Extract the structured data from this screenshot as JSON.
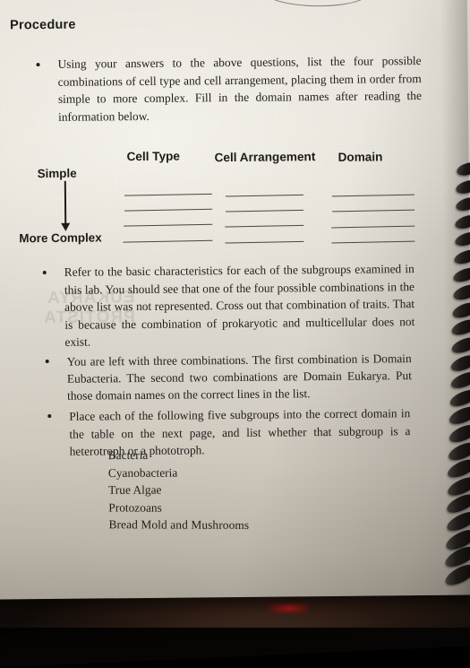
{
  "document": {
    "section_heading": "Procedure",
    "media": "photograph of a spiral-bound lab manual page"
  },
  "instructions": [
    {
      "id": "bullet-1",
      "text": "Using your answers to the above questions, list the four possible combinations of cell type and cell arrangement, placing them in order from simple to more complex. Fill in the domain names after reading the information below."
    },
    {
      "id": "bullet-2",
      "text": "Refer to the basic characteristics for each of the subgroups examined in this lab. You should see that one of the four possible combinations in the above list was not represented. Cross out that combination of traits. That is because the combination of prokaryotic and multicellular does not exist."
    },
    {
      "id": "bullet-3",
      "text": "You are left with three combinations. The first combination is Domain Eubacteria. The second two combinations are Domain Eukarya. Put those domain names on the correct lines in the list."
    },
    {
      "id": "bullet-4",
      "text": "Place each of the following five subgroups into the correct domain in the table on the next page, and list whether that subgroup is a heterotroph or a phototroph."
    }
  ],
  "answer_table": {
    "columns": [
      "Cell Type",
      "Cell Arrangement",
      "Domain"
    ],
    "rows_count": 4,
    "row_values": [
      [
        "",
        "",
        ""
      ],
      [
        "",
        "",
        ""
      ],
      [
        "",
        "",
        ""
      ],
      [
        "",
        "",
        ""
      ]
    ],
    "axis_label_top": "Simple",
    "axis_label_bottom": "More Complex",
    "axis_direction_icon": "down-arrow-icon"
  },
  "subgroups": [
    "Bacteria",
    "Cyanobacteria",
    "True Algae",
    "Protozoans",
    "Bread Mold and Mushrooms"
  ],
  "ghost_text": {
    "line_1": "EUKARYA",
    "line_2": "PROTISTA"
  },
  "colors": {
    "paper": "#e5e1d8",
    "paper_shadow": "#a9a297",
    "ink": "#201e1b",
    "rule_line": "#4a463f",
    "spiral": "#1d1a18",
    "backdrop": "#100b08",
    "accent_red": "#af1916"
  }
}
